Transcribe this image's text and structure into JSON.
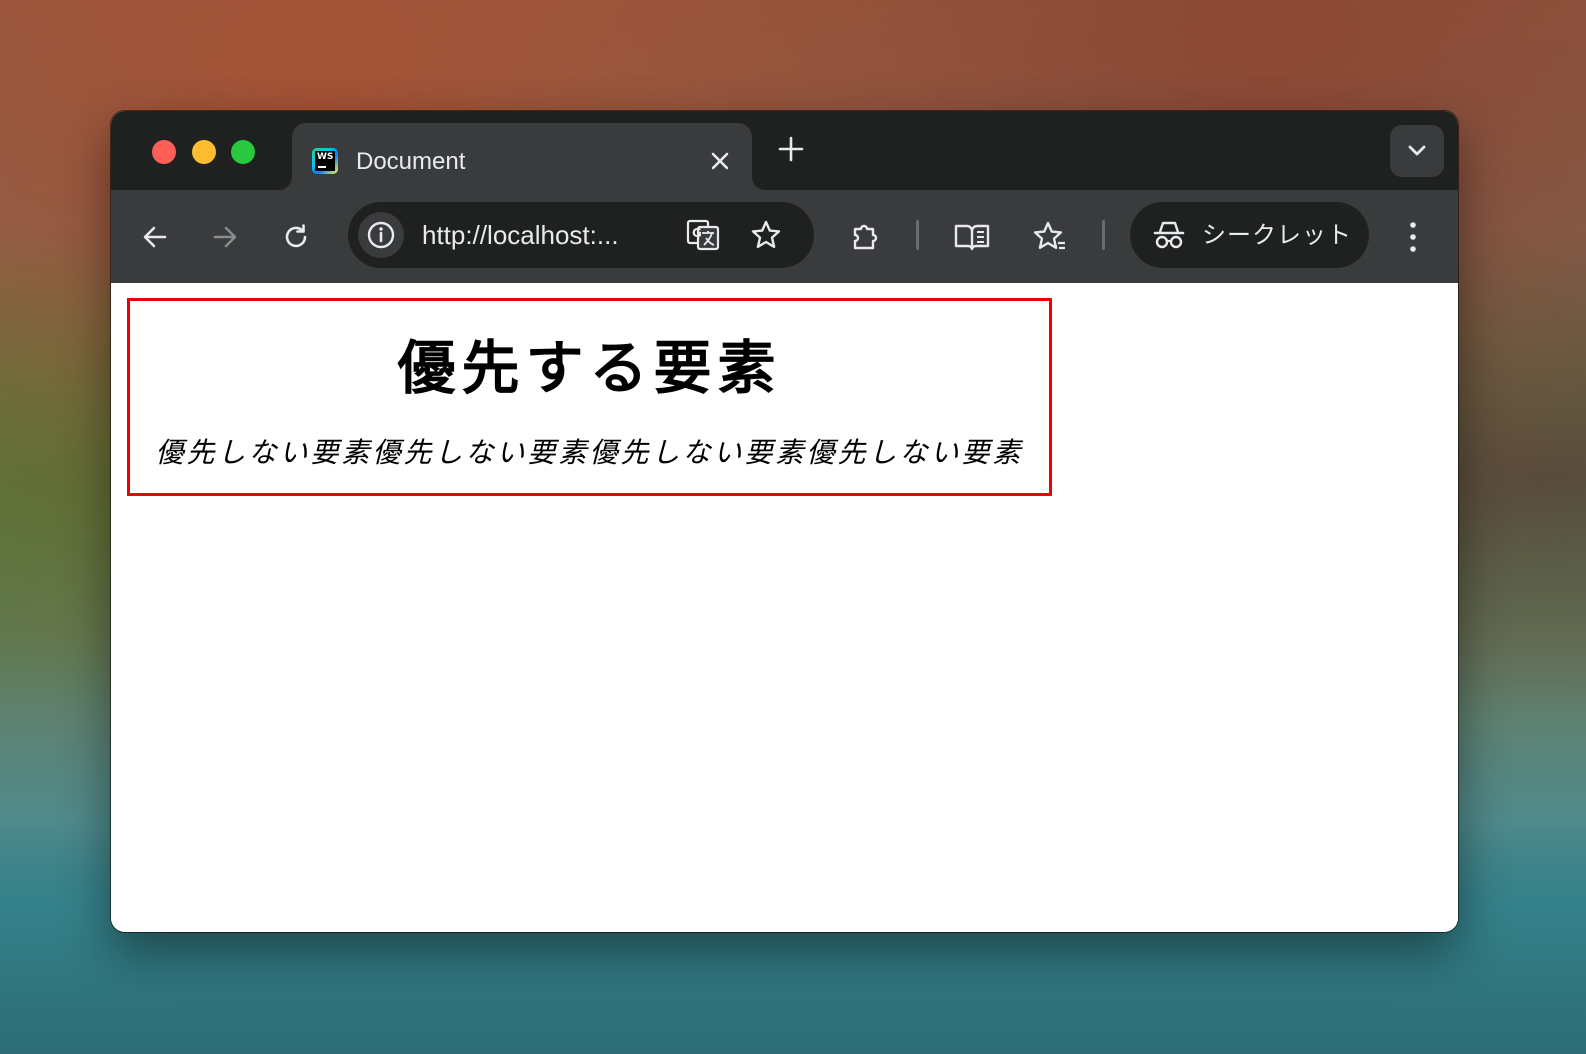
{
  "tab": {
    "title": "Document",
    "favicon_text": "WS"
  },
  "toolbar": {
    "url": "http://localhost:...",
    "incognito_label": "シークレット"
  },
  "page": {
    "heading": "優先する要素",
    "subtext": "優先しない要素優先しない要素優先しない要素優先しない要素"
  },
  "colors": {
    "box_border": "#f00000",
    "titlebar": "#1f2020",
    "toolbar": "#3a3b3c"
  }
}
